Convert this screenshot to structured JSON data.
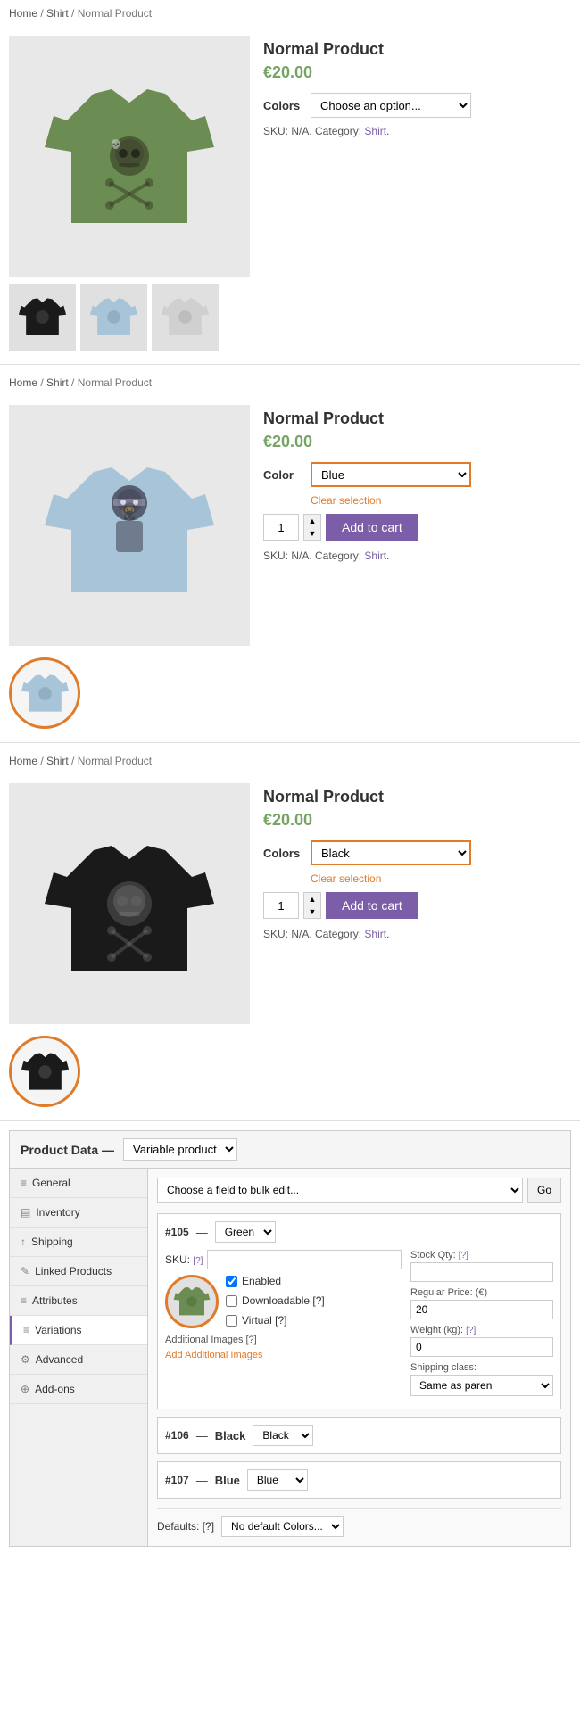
{
  "sections": [
    {
      "breadcrumb": [
        "Home",
        "Shirt",
        "Normal Product"
      ],
      "product": {
        "title": "Normal Product",
        "price": "€20.00",
        "color_label": "Colors",
        "color_placeholder": "Choose an option...",
        "color_value": "",
        "show_add_to_cart": false,
        "sku_text": "SKU: N/A. Category:",
        "category": "Shirt",
        "tshirt_color": "green",
        "thumbnails": [
          "black",
          "blue",
          "white"
        ]
      }
    },
    {
      "breadcrumb": [
        "Home",
        "Shirt",
        "Normal Product"
      ],
      "product": {
        "title": "Normal Product",
        "price": "€20.00",
        "color_label": "Color",
        "color_value": "Blue",
        "show_add_to_cart": true,
        "qty": "1",
        "add_to_cart_label": "Add to cart",
        "clear_selection": "Clear selection",
        "sku_text": "SKU: N/A. Category:",
        "category": "Shirt",
        "tshirt_color": "blue",
        "active_thumbnail": "blue"
      }
    },
    {
      "breadcrumb": [
        "Home",
        "Shirt",
        "Normal Product"
      ],
      "product": {
        "title": "Normal Product",
        "price": "€20.00",
        "color_label": "Colors",
        "color_value": "Black",
        "show_add_to_cart": true,
        "qty": "1",
        "add_to_cart_label": "Add to cart",
        "clear_selection": "Clear selection",
        "sku_text": "SKU: N/A. Category:",
        "category": "Shirt",
        "tshirt_color": "black",
        "active_thumbnail": "black"
      }
    }
  ],
  "product_data": {
    "header_title": "Product Data —",
    "type_select": "Variable product",
    "bulk_edit_placeholder": "Choose a field to bulk edit...",
    "go_button": "Go",
    "sidebar_items": [
      {
        "id": "general",
        "label": "General",
        "icon": "≡",
        "active": false
      },
      {
        "id": "inventory",
        "label": "Inventory",
        "icon": "📦",
        "active": false
      },
      {
        "id": "shipping",
        "label": "Shipping",
        "icon": "🚚",
        "active": false
      },
      {
        "id": "linked-products",
        "label": "Linked Products",
        "icon": "🔗",
        "active": false
      },
      {
        "id": "attributes",
        "label": "Attributes",
        "icon": "≡",
        "active": false
      },
      {
        "id": "variations",
        "label": "Variations",
        "icon": "≡",
        "active": true
      },
      {
        "id": "advanced",
        "label": "Advanced",
        "icon": "⚙",
        "active": false
      },
      {
        "id": "add-ons",
        "label": "Add-ons",
        "icon": "+",
        "active": false
      }
    ],
    "variations": [
      {
        "id": "#105",
        "color": "Green",
        "sku_label": "SKU: [?]",
        "enabled_checked": true,
        "downloadable_checked": false,
        "virtual_checked": false,
        "enabled_label": "Enabled",
        "downloadable_label": "Downloadable [?]",
        "virtual_label": "Virtual [?]",
        "additional_images_label": "Additional Images [?]",
        "add_images_link": "Add Additional Images",
        "stock_qty_label": "Stock Qty: [?]",
        "regular_price_label": "Regular Price: (€)",
        "regular_price": "20",
        "weight_label": "Weight (kg): [?]",
        "weight": "0",
        "shipping_class_label": "Shipping class:",
        "shipping_class": "Same as paren",
        "tshirt_color": "green",
        "show_circled_image": true
      },
      {
        "id": "#106",
        "color": "Black",
        "collapsed": true
      },
      {
        "id": "#107",
        "color": "Blue",
        "collapsed": true
      }
    ],
    "defaults_label": "Defaults: [?]",
    "defaults_value": "No default Colors..."
  }
}
